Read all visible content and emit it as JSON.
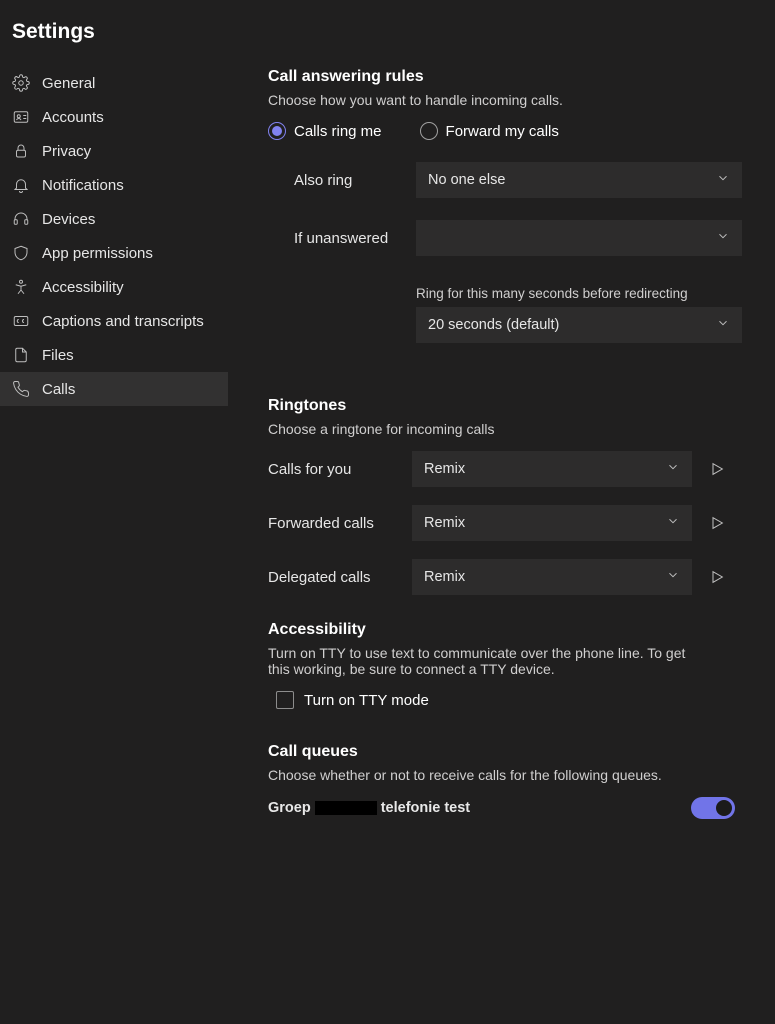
{
  "page_title": "Settings",
  "sidebar": {
    "items": [
      {
        "label": "General"
      },
      {
        "label": "Accounts"
      },
      {
        "label": "Privacy"
      },
      {
        "label": "Notifications"
      },
      {
        "label": "Devices"
      },
      {
        "label": "App permissions"
      },
      {
        "label": "Accessibility"
      },
      {
        "label": "Captions and transcripts"
      },
      {
        "label": "Files"
      },
      {
        "label": "Calls"
      }
    ]
  },
  "call_rules": {
    "title": "Call answering rules",
    "desc": "Choose how you want to handle incoming calls.",
    "radio_ring": "Calls ring me",
    "radio_forward": "Forward my calls",
    "also_ring_label": "Also ring",
    "also_ring_value": "No one else",
    "if_unanswered_label": "If unanswered",
    "if_unanswered_value": "",
    "ring_seconds_helper": "Ring for this many seconds before redirecting",
    "ring_seconds_value": "20 seconds (default)"
  },
  "ringtones": {
    "title": "Ringtones",
    "desc": "Choose a ringtone for incoming calls",
    "rows": [
      {
        "label": "Calls for you",
        "value": "Remix"
      },
      {
        "label": "Forwarded calls",
        "value": "Remix"
      },
      {
        "label": "Delegated calls",
        "value": "Remix"
      }
    ]
  },
  "accessibility": {
    "title": "Accessibility",
    "desc": "Turn on TTY to use text to communicate over the phone line. To get this working, be sure to connect a TTY device.",
    "checkbox_label": "Turn on TTY mode"
  },
  "call_queues": {
    "title": "Call queues",
    "desc": "Choose whether or not to receive calls for the following queues.",
    "queue_prefix": "Groep",
    "queue_suffix": "telefonie test"
  }
}
